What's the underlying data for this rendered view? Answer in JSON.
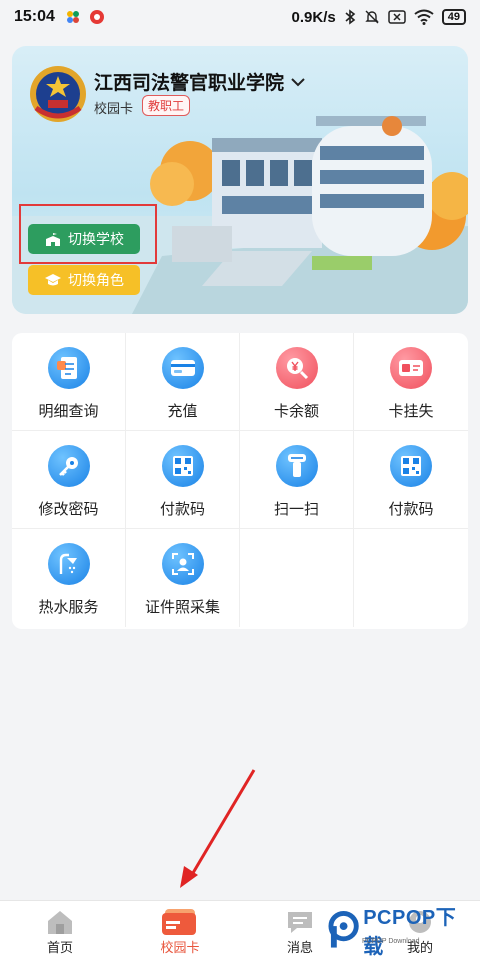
{
  "status": {
    "time": "15:04",
    "network_speed": "0.9K/s",
    "battery": "49"
  },
  "hero": {
    "school_name": "江西司法警官职业学院",
    "card_label": "校园卡",
    "role": "教职工",
    "switch_school": "切换学校",
    "switch_role": "切换角色"
  },
  "services": [
    {
      "label": "明细查询",
      "icon": "receipt-icon",
      "color": "#1a82e6"
    },
    {
      "label": "充值",
      "icon": "card-icon",
      "color": "#1a82e6"
    },
    {
      "label": "卡余额",
      "icon": "yen-search-icon",
      "color": "#f0505d"
    },
    {
      "label": "卡挂失",
      "icon": "lost-card-icon",
      "color": "#f0505d"
    },
    {
      "label": "修改密码",
      "icon": "key-icon",
      "color": "#1a82e6"
    },
    {
      "label": "付款码",
      "icon": "qr-code-icon",
      "color": "#1a82e6"
    },
    {
      "label": "扫一扫",
      "icon": "scanner-icon",
      "color": "#1a82e6"
    },
    {
      "label": "付款码",
      "icon": "qr-code-icon",
      "color": "#1a82e6"
    },
    {
      "label": "热水服务",
      "icon": "shower-icon",
      "color": "#1a82e6"
    },
    {
      "label": "证件照采集",
      "icon": "id-photo-icon",
      "color": "#1a82e6"
    }
  ],
  "tabs": [
    {
      "label": "首页",
      "icon": "home-icon"
    },
    {
      "label": "校园卡",
      "icon": "campus-card-icon",
      "active": true
    },
    {
      "label": "消息",
      "icon": "message-icon"
    },
    {
      "label": "我的",
      "icon": "profile-icon"
    }
  ],
  "watermark": {
    "text": "PCPOP下载",
    "sub": "PCPOP Download"
  },
  "colors": {
    "accent": "#e8553c",
    "primary_blue": "#1a82e6",
    "alert_red": "#f0505d",
    "green_button": "#2d9d5f",
    "yellow_button": "#f6c027"
  }
}
